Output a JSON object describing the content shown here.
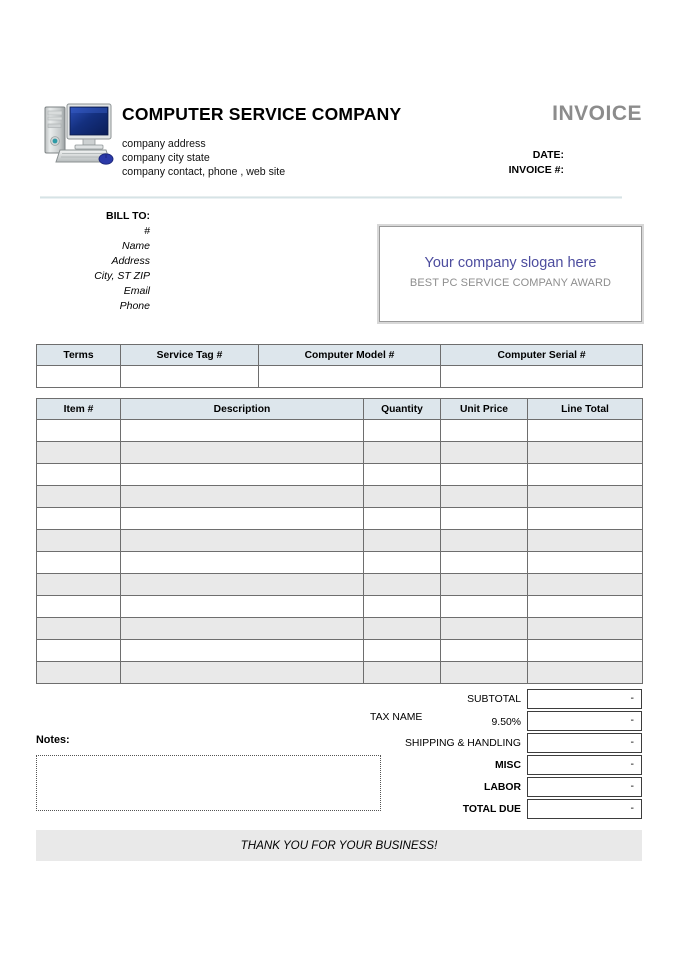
{
  "document": {
    "type": "invoice-template",
    "title_word": "INVOICE"
  },
  "header": {
    "logo_icon": "desktop-computer-icon",
    "company_name": "COMPUTER SERVICE COMPANY",
    "company_address": "company address",
    "company_city_state": "company city state",
    "company_contact": "company contact, phone , web site",
    "invoice_word": "INVOICE",
    "date_label": "DATE:",
    "invoice_no_label": "INVOICE #:"
  },
  "bill_to": {
    "heading": "BILL TO:",
    "fields": [
      "#",
      "Name",
      "Address",
      "City, ST ZIP",
      "Email",
      "Phone"
    ]
  },
  "slogan": {
    "main": "Your company slogan here",
    "sub": "BEST PC SERVICE COMPANY AWARD",
    "main_color": "#4c4c9e",
    "sub_color": "#8e8e8e"
  },
  "terms_table": {
    "headers": [
      "Terms",
      "Service Tag #",
      "Computer Model #",
      "Computer Serial #"
    ],
    "rows": [
      [
        "",
        "",
        "",
        ""
      ]
    ]
  },
  "items_table": {
    "headers": [
      "Item #",
      "Description",
      "Quantity",
      "Unit Price",
      "Line Total"
    ],
    "row_count": 12,
    "rows": [
      [
        "",
        "",
        "",
        "",
        ""
      ],
      [
        "",
        "",
        "",
        "",
        ""
      ],
      [
        "",
        "",
        "",
        "",
        ""
      ],
      [
        "",
        "",
        "",
        "",
        ""
      ],
      [
        "",
        "",
        "",
        "",
        ""
      ],
      [
        "",
        "",
        "",
        "",
        ""
      ],
      [
        "",
        "",
        "",
        "",
        ""
      ],
      [
        "",
        "",
        "",
        "",
        ""
      ],
      [
        "",
        "",
        "",
        "",
        ""
      ],
      [
        "",
        "",
        "",
        "",
        ""
      ],
      [
        "",
        "",
        "",
        "",
        ""
      ],
      [
        "",
        "",
        "",
        "",
        ""
      ]
    ]
  },
  "totals": {
    "subtotal_label": "SUBTOTAL",
    "subtotal_value": "-",
    "tax_name_label": "TAX NAME",
    "tax_rate": "9.50%",
    "tax_value": "-",
    "shipping_label": "SHIPPING & HANDLING",
    "shipping_value": "-",
    "misc_label": "MISC",
    "misc_value": "-",
    "labor_label": "LABOR",
    "labor_value": "-",
    "total_due_label": "TOTAL DUE",
    "total_due_value": "-"
  },
  "notes": {
    "label": "Notes:",
    "value": ""
  },
  "footer": {
    "thank_you": "THANK YOU FOR YOUR BUSINESS!"
  },
  "colors": {
    "table_header_fill": "#dde6ec",
    "row_band": "#e9e9e9",
    "footer_bar": "#e9e9e9",
    "invoice_word": "#8c8c8c",
    "divider": "#cfdee1"
  }
}
